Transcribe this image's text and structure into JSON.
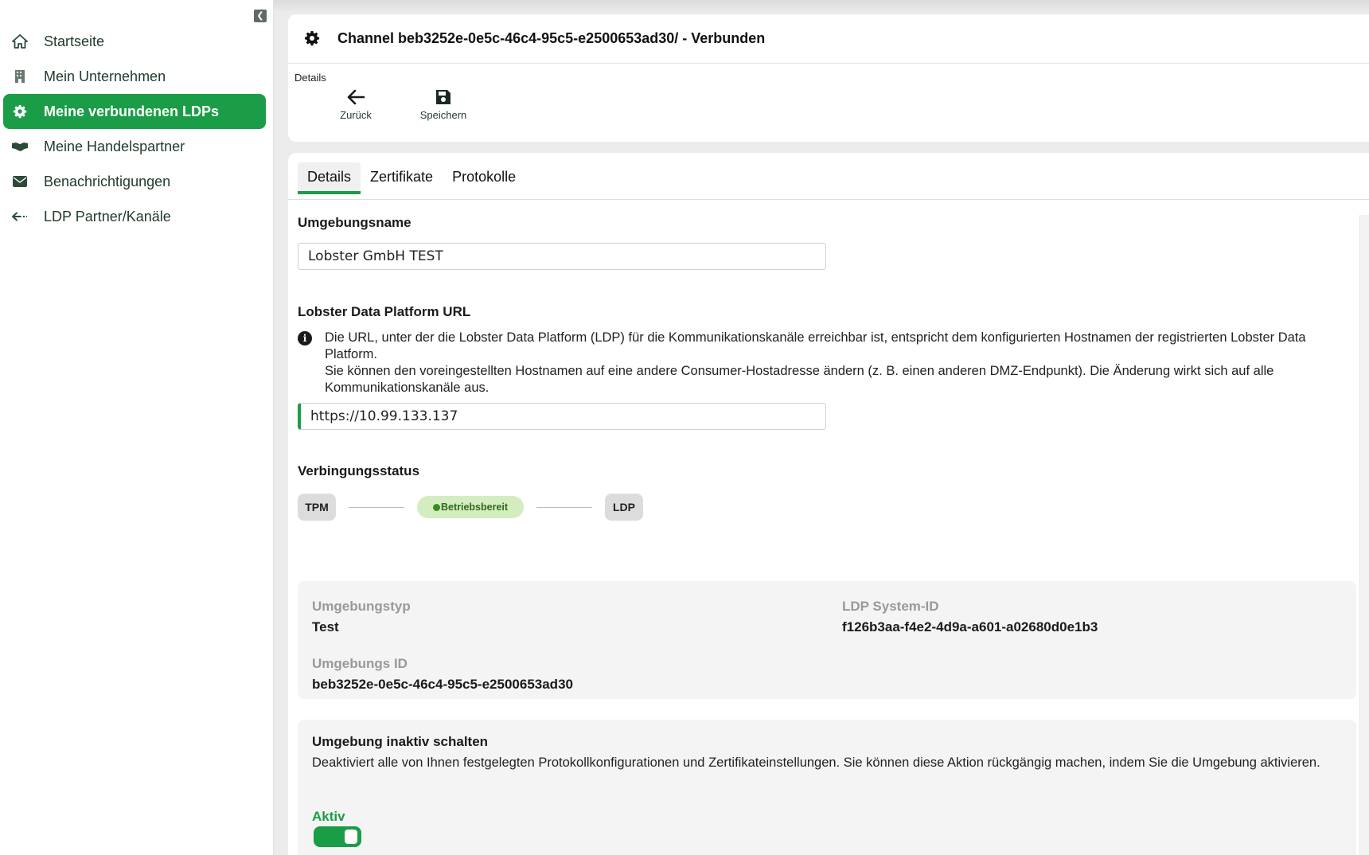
{
  "sidebar": {
    "items": [
      {
        "label": "Startseite",
        "icon": "home-icon"
      },
      {
        "label": "Mein Unternehmen",
        "icon": "building-icon"
      },
      {
        "label": "Meine verbundenen LDPs",
        "icon": "gear-icon",
        "active": true
      },
      {
        "label": "Meine Handelspartner",
        "icon": "handshake-icon"
      },
      {
        "label": "Benachrichtigungen",
        "icon": "envelope-icon"
      },
      {
        "label": "LDP Partner/Kanäle",
        "icon": "arrows-icon"
      }
    ]
  },
  "header": {
    "title": "Channel beb3252e-0e5c-46c4-95c5-e2500653ad30/ - Verbunden",
    "subtitle": "Details",
    "back_label": "Zurück",
    "save_label": "Speichern"
  },
  "tabs": [
    "Details",
    "Zertifikate",
    "Protokolle"
  ],
  "form": {
    "env_name_label": "Umgebungsname",
    "env_name_value": "Lobster GmbH TEST",
    "url_label": "Lobster Data Platform URL",
    "url_info_1": "Die URL, unter der die Lobster Data Platform (LDP) für die Kommunikationskanäle erreichbar ist, entspricht dem konfigurierten Hostnamen der registrierten Lobster Data Platform.",
    "url_info_2": "Sie können den voreingestellten Hostnamen auf eine andere Consumer-Hostadresse ändern (z. B. einen anderen DMZ-Endpunkt). Die Änderung wirkt sich auf alle Kommunikationskanäle aus.",
    "url_value": "https://10.99.133.137"
  },
  "status": {
    "label": "Verbingungsstatus",
    "left_node": "TPM",
    "state": "Betriebsbereit",
    "right_node": "LDP",
    "state_color": "#3a8a1e"
  },
  "details": {
    "env_type_label": "Umgebungstyp",
    "env_type_value": "Test",
    "system_id_label": "LDP System-ID",
    "system_id_value": "f126b3aa-f4e2-4d9a-a601-a02680d0e1b3",
    "env_id_label": "Umgebungs ID",
    "env_id_value": "beb3252e-0e5c-46c4-95c5-e2500653ad30"
  },
  "deactivate": {
    "title": "Umgebung inaktiv schalten",
    "text": "Deaktiviert alle von Ihnen festgelegten Protokollkonfigurationen und Zertifikateinstellungen. Sie können diese Aktion rückgängig machen, indem Sie die Umgebung aktivieren.",
    "state_label": "Aktiv",
    "toggle_on": true
  },
  "colors": {
    "accent": "#1a9d46"
  }
}
